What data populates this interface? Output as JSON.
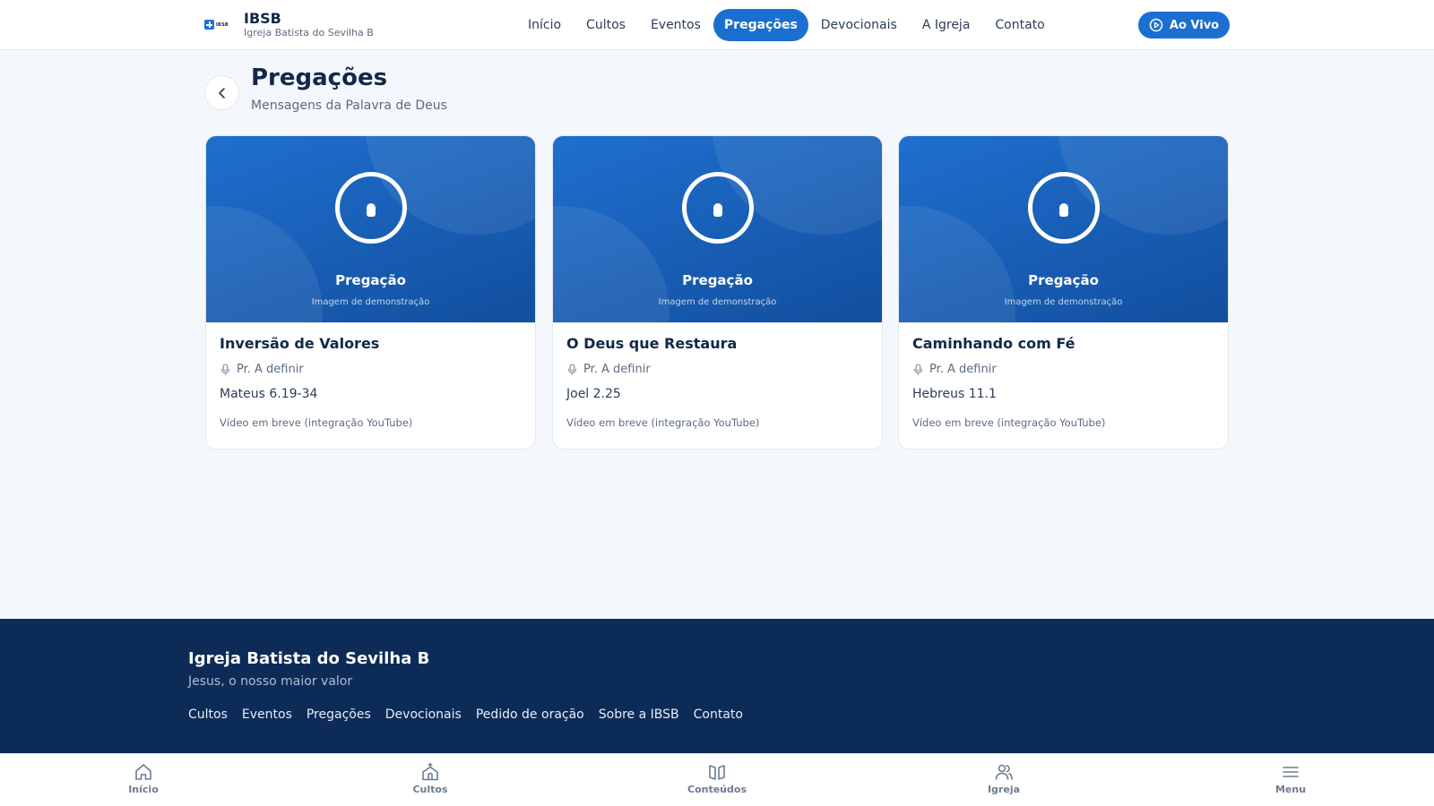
{
  "header": {
    "logo_text": "IBSB",
    "brand_name": "IBSB",
    "brand_sub": "Igreja Batista do Sevilha B",
    "nav": [
      {
        "label": "Início"
      },
      {
        "label": "Cultos"
      },
      {
        "label": "Eventos"
      },
      {
        "label": "Pregações",
        "active": true
      },
      {
        "label": "Devocionais"
      },
      {
        "label": "A Igreja"
      },
      {
        "label": "Contato"
      }
    ],
    "live_label": "Ao Vivo",
    "accent": "#1b6fd1"
  },
  "page": {
    "title": "Pregações",
    "subtitle": "Mensagens da Palavra de Deus"
  },
  "sermons": [
    {
      "media_label": "Pregação",
      "media_demo": "Imagem de demonstração",
      "title": "Inversão de Valores",
      "preacher": "Pr. A definir",
      "reference": "Mateus 6.19-34",
      "video_note": "Vídeo em breve (integração YouTube)"
    },
    {
      "media_label": "Pregação",
      "media_demo": "Imagem de demonstração",
      "title": "O Deus que Restaura",
      "preacher": "Pr. A definir",
      "reference": "Joel 2.25",
      "video_note": "Vídeo em breve (integração YouTube)"
    },
    {
      "media_label": "Pregação",
      "media_demo": "Imagem de demonstração",
      "title": "Caminhando com Fé",
      "preacher": "Pr. A definir",
      "reference": "Hebreus 11.1",
      "video_note": "Vídeo em breve (integração YouTube)"
    }
  ],
  "footer": {
    "title": "Igreja Batista do Sevilha B",
    "tagline": "Jesus, o nosso maior valor",
    "links": [
      "Cultos",
      "Eventos",
      "Pregações",
      "Devocionais",
      "Pedido de oração",
      "Sobre a IBSB",
      "Contato"
    ],
    "background": "#0d2b57"
  },
  "tabbar": [
    {
      "label": "Início",
      "icon": "home-icon"
    },
    {
      "label": "Cultos",
      "icon": "church-icon"
    },
    {
      "label": "Conteúdos",
      "icon": "book-icon"
    },
    {
      "label": "Igreja",
      "icon": "people-icon"
    },
    {
      "label": "Menu",
      "icon": "menu-icon"
    }
  ]
}
